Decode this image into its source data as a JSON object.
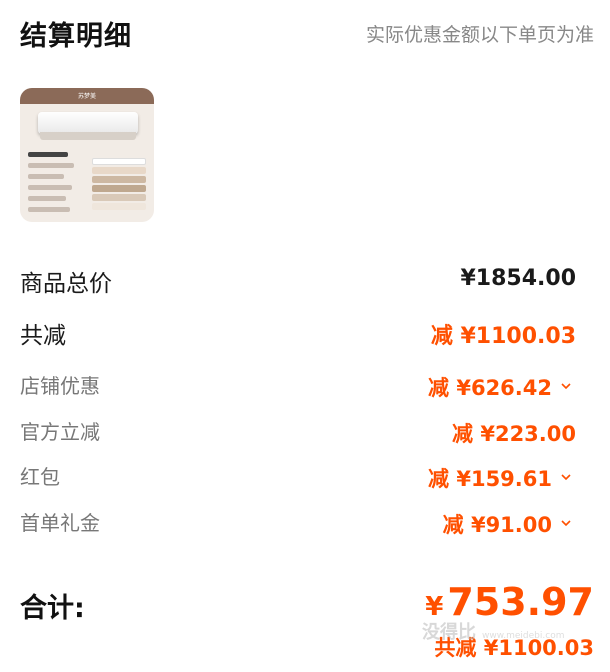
{
  "header": {
    "title": "结算明细",
    "subtitle": "实际优惠金额以下单页为准"
  },
  "product": {
    "image_band_text": "苏梦美",
    "image_name": "mattress-product-image"
  },
  "summary": {
    "total_price": {
      "label": "商品总价",
      "value": "¥1854.00"
    },
    "total_reduce": {
      "label": "共减",
      "value": "减 ¥1100.03"
    }
  },
  "discounts": [
    {
      "label": "店铺优惠",
      "value": "减 ¥626.42",
      "expandable": true
    },
    {
      "label": "官方立减",
      "value": "减 ¥223.00",
      "expandable": false
    },
    {
      "label": "红包",
      "value": "减 ¥159.61",
      "expandable": true
    },
    {
      "label": "首单礼金",
      "value": "减 ¥91.00",
      "expandable": true
    }
  ],
  "total": {
    "label": "合计:",
    "currency": "¥",
    "amount": "753.97",
    "reduce_text": "共减 ¥1100.03"
  },
  "watermark": {
    "text": "没得比",
    "subtext": "www.meidebi.com"
  },
  "colors": {
    "accent": "#ff5000",
    "text": "#1a1a1a",
    "muted": "#888888"
  }
}
